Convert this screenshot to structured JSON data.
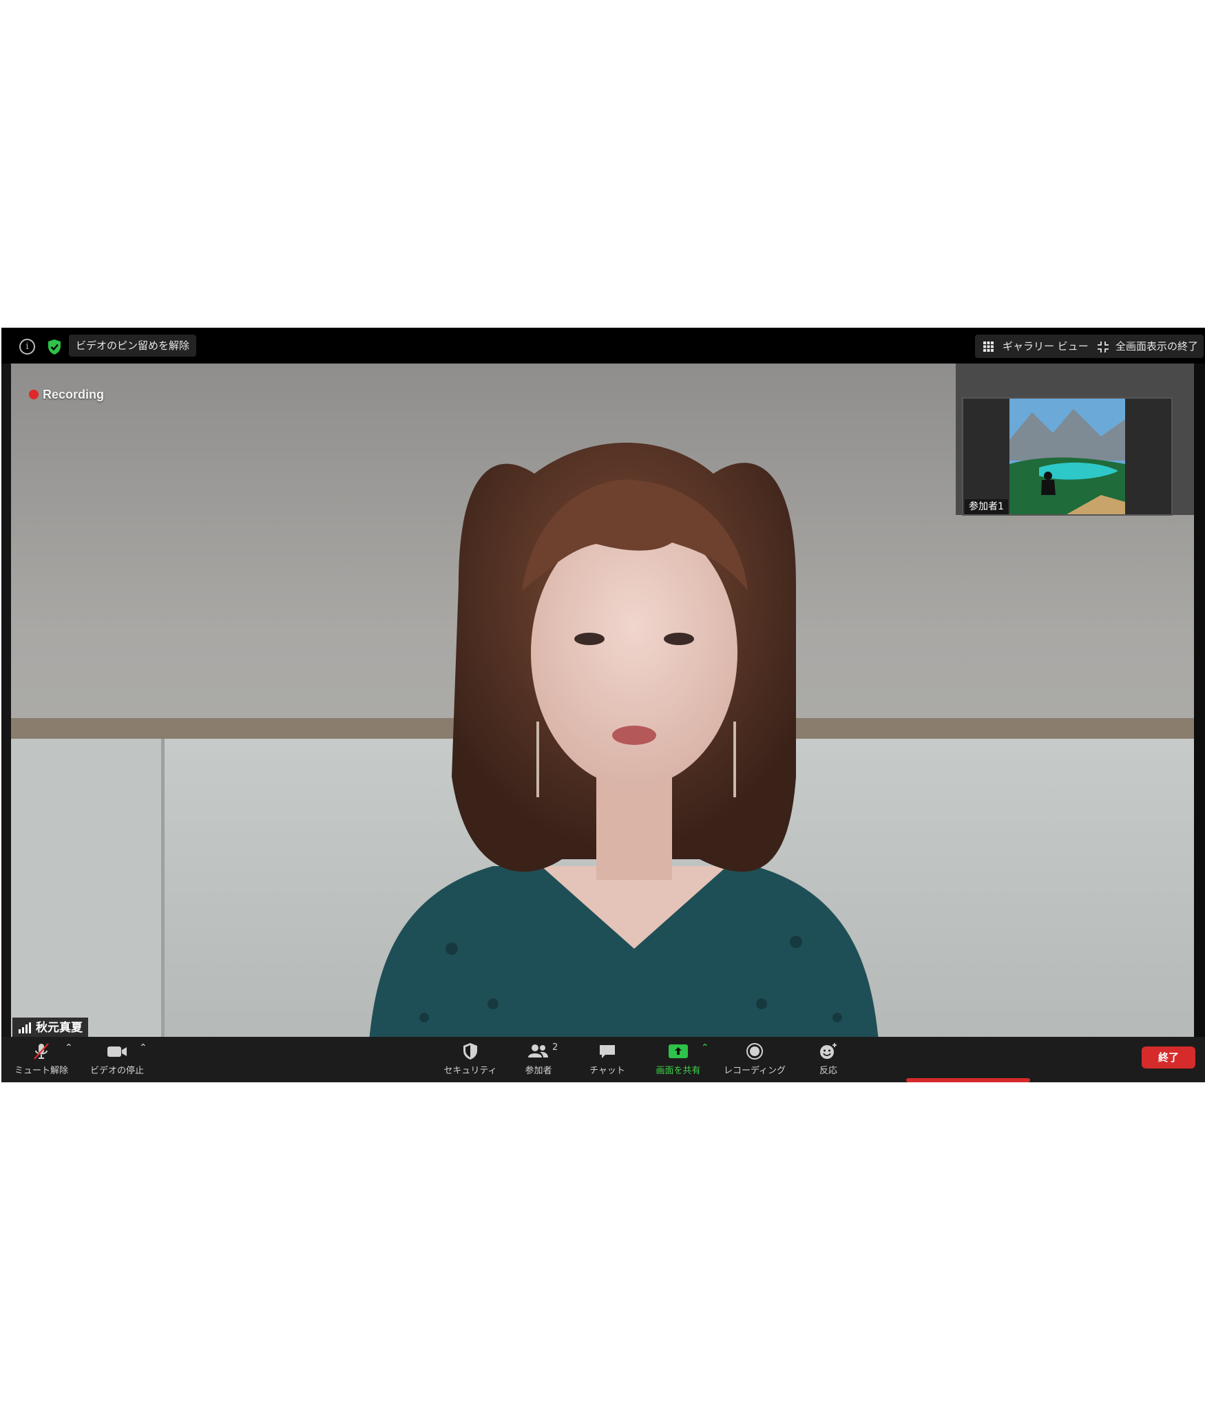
{
  "topbar": {
    "info_icon": "info-icon",
    "shield_icon": "shield-check-icon",
    "unpin_label": "ビデオのピン留めを解除",
    "gallery_label": "ギャラリー ビュー",
    "exit_fullscreen_label": "全画面表示の終了"
  },
  "main_video": {
    "recording_label": "Recording",
    "speaker_name": "秋元真夏"
  },
  "thumbnail": {
    "participant_name": "参加者1"
  },
  "toolbar": {
    "mute_label": "ミュート解除",
    "video_label": "ビデオの停止",
    "security_label": "セキュリティ",
    "participants_label": "参加者",
    "participants_count": "2",
    "chat_label": "チャット",
    "share_label": "画面を共有",
    "recording_label": "レコーディング",
    "reactions_label": "反応",
    "end_label": "終了"
  },
  "colors": {
    "share_green": "#3fd24a",
    "end_red": "#d62b2b",
    "recording_red": "#e02828"
  }
}
